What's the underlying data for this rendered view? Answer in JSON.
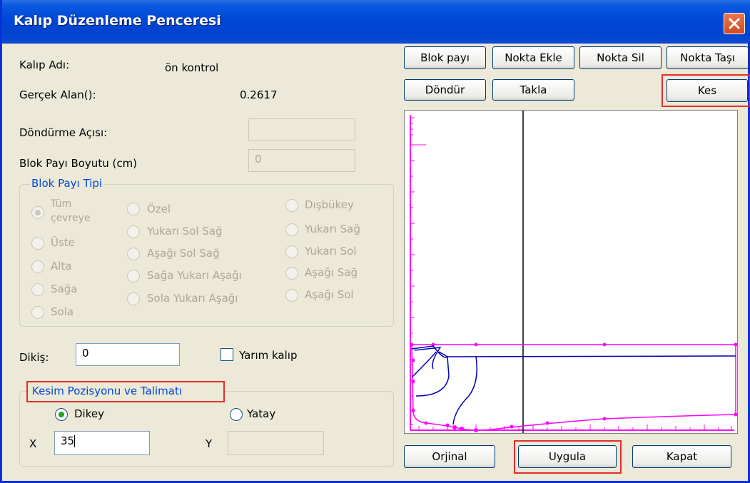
{
  "window": {
    "title": "Kalıp Düzenleme Penceresi"
  },
  "info": {
    "name_label": "Kalıp Adı:",
    "name_value": "ön kontrol",
    "area_label": "Gerçek Alan():",
    "area_value": "0.2617",
    "rotate_label": "Döndürme Açısı:",
    "rotate_value": "",
    "block_size_label": "Blok Payı Boyutu (cm)",
    "block_size_value": "0"
  },
  "block_type": {
    "title": "Blok Payı Tipi",
    "options": [
      {
        "label_line1": "Tüm",
        "label_line2": "çevreye",
        "selected": true
      },
      {
        "label": "Üste"
      },
      {
        "label": "Alta"
      },
      {
        "label": "Sağa"
      },
      {
        "label": "Sola"
      },
      {
        "label": "Özel"
      },
      {
        "label": "Yukarı Sol Sağ"
      },
      {
        "label": "Aşağı Sol Sağ"
      },
      {
        "label": "Sağa Yukarı Aşağı"
      },
      {
        "label": "Sola Yukarı Aşağı"
      },
      {
        "label": "Dışbükey"
      },
      {
        "label": "Yukarı Sağ"
      },
      {
        "label": "Yukarı Sol"
      },
      {
        "label": "Aşağı Sağ"
      },
      {
        "label": "Aşağı Sol"
      }
    ]
  },
  "seam": {
    "label": "Dikiş:",
    "value": "0",
    "half_mold_label": "Yarım kalıp",
    "half_mold_checked": false
  },
  "cut": {
    "title": "Kesim Pozisyonu ve Talimatı",
    "vertical_label": "Dikey",
    "horizontal_label": "Yatay",
    "selected": "Dikey",
    "x_label": "X",
    "x_value": "35",
    "y_label": "Y",
    "y_value": ""
  },
  "toolbar": {
    "block": "Blok payı",
    "add_point": "Nokta Ekle",
    "delete_point": "Nokta Sil",
    "move_point": "Nokta Taşı",
    "rotate": "Döndür",
    "flip": "Takla",
    "cut": "Kes"
  },
  "footer": {
    "original": "Orjinal",
    "apply": "Uygula",
    "close": "Kapat"
  },
  "colors": {
    "title_bar": "#0047d6",
    "highlight": "#e32d2d",
    "pattern_outline": "#ff00ff",
    "pattern_line": "#0000b4"
  }
}
